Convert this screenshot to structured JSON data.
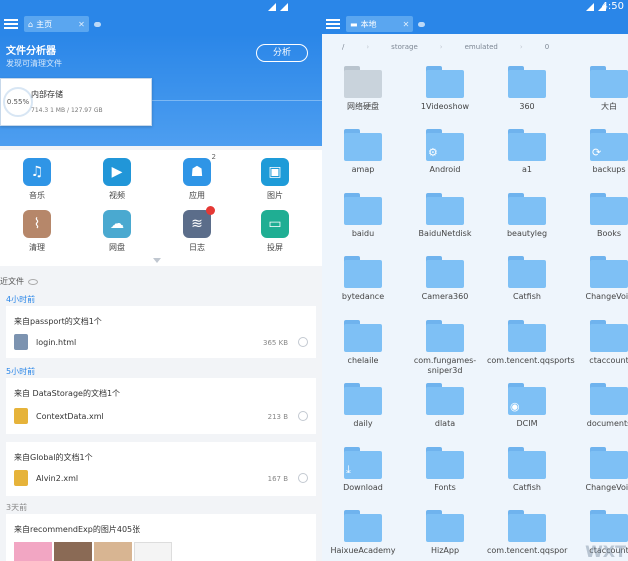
{
  "status_bar": {
    "time": "4:50"
  },
  "left": {
    "tab": {
      "label": "主页"
    },
    "header": {
      "title": "文件分析器",
      "subtitle": "发现可清理文件",
      "analyze_label": "分析"
    },
    "storage": {
      "percent": "0.55%",
      "name": "内部存储",
      "size": "714.3 1 MB / 127.97 GB"
    },
    "categories": [
      {
        "label": "音乐",
        "icon": "music-icon",
        "color": "#2f95e6"
      },
      {
        "label": "视频",
        "icon": "video-icon",
        "color": "#2196d8"
      },
      {
        "label": "应用",
        "icon": "android-icon",
        "color": "#2f95e6",
        "badge": "2"
      },
      {
        "label": "图片",
        "icon": "image-icon",
        "color": "#1e9bd8"
      },
      {
        "label": "清理",
        "icon": "broom-icon",
        "color": "#b6876a"
      },
      {
        "label": "网盘",
        "icon": "cloud-icon",
        "color": "#4aa9d0"
      },
      {
        "label": "日志",
        "icon": "layers-icon",
        "color": "#5b6d8a"
      },
      {
        "label": "投屏",
        "icon": "cast-icon",
        "color": "#1fae93"
      }
    ],
    "recent": {
      "heading": "近文件",
      "groups": [
        {
          "title": "4小时前",
          "card_title": "来自passport的文档1个",
          "file": "login.html",
          "size": "365 KB",
          "icon_color": "#7c93b0"
        },
        {
          "title": "5小时前",
          "card_title": "来自 DataStorage的文档1个",
          "file": "ContextData.xml",
          "size": "213 B",
          "icon_color": "#e6b33a"
        },
        {
          "title": "",
          "card_title": "来自Global的文档1个",
          "file": "Alvin2.xml",
          "size": "167 B",
          "icon_color": "#e6b33a"
        },
        {
          "title": "3天前",
          "card_title": "来自recommendExp的图片405张"
        }
      ]
    },
    "colors": {
      "accent": "#2a86e8",
      "group_title": "#2a86e8"
    }
  },
  "right": {
    "tab": {
      "label": "本地"
    },
    "breadcrumb": [
      "/",
      "storage",
      "emulated",
      "0"
    ],
    "folders": [
      {
        "name": "网络硬盘",
        "special": "netdisk"
      },
      {
        "name": "1Videoshow"
      },
      {
        "name": "360"
      },
      {
        "name": "大白"
      },
      {
        "name": "amap"
      },
      {
        "name": "Android",
        "mark": "⚙"
      },
      {
        "name": "a1"
      },
      {
        "name": "backups",
        "mark": "⟳"
      },
      {
        "name": "baidu"
      },
      {
        "name": "BaiduNetdisk"
      },
      {
        "name": "beautyleg"
      },
      {
        "name": "Books"
      },
      {
        "name": "bytedance"
      },
      {
        "name": "Camera360"
      },
      {
        "name": "Catfish"
      },
      {
        "name": "ChangeVoic"
      },
      {
        "name": "chelaile"
      },
      {
        "name": "com.fungames-sniper3d"
      },
      {
        "name": "com.tencent.qqsports"
      },
      {
        "name": "ctaccount"
      },
      {
        "name": "daily"
      },
      {
        "name": "dlata"
      },
      {
        "name": "DCIM",
        "mark": "◉"
      },
      {
        "name": "documents"
      },
      {
        "name": "Download",
        "mark": "⤓"
      },
      {
        "name": "Fonts"
      },
      {
        "name": "Catfish"
      },
      {
        "name": "ChangeVoic"
      },
      {
        "name": "HaixueAcademy"
      },
      {
        "name": "HizApp"
      },
      {
        "name": "com.tencent.qqspor"
      },
      {
        "name": "ctaccount"
      }
    ],
    "watermark": "WXT"
  }
}
